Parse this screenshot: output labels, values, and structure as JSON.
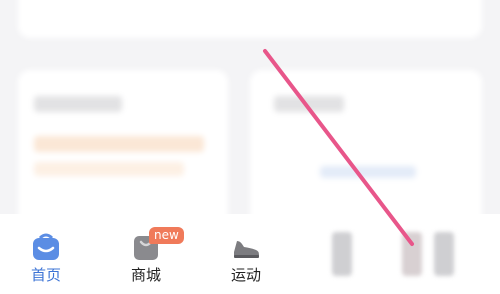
{
  "tabs": [
    {
      "label": "首页",
      "icon": "home-icon",
      "active": true
    },
    {
      "label": "商城",
      "icon": "shopping-bag-icon",
      "active": false,
      "badge": "new"
    },
    {
      "label": "运动",
      "icon": "sneaker-icon",
      "active": false
    }
  ],
  "colors": {
    "accent": "#3d74d6",
    "badge": "#f07a5a",
    "swipe_line": "#e8568a"
  }
}
